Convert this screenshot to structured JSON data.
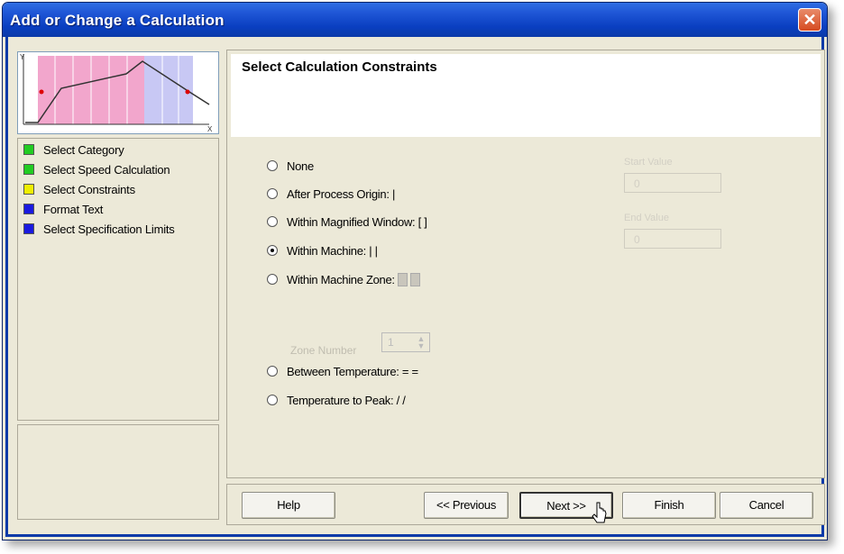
{
  "window": {
    "title": "Add or Change a Calculation",
    "close_label": "✕"
  },
  "preview": {
    "axis_y": "Y",
    "axis_x": "X"
  },
  "steps": [
    {
      "label": "Select Category",
      "color": "#22cc22"
    },
    {
      "label": "Select Speed Calculation",
      "color": "#22cc22"
    },
    {
      "label": "Select Constraints",
      "color": "#eeee00"
    },
    {
      "label": "Format Text",
      "color": "#1a1adf"
    },
    {
      "label": "Select Specification Limits",
      "color": "#1a1adf"
    }
  ],
  "main": {
    "title": "Select Calculation Constraints",
    "options": [
      {
        "label": "None",
        "checked": false
      },
      {
        "label": "After Process Origin: |",
        "checked": false
      },
      {
        "label": "Within Magnified Window: [  ]",
        "checked": false
      },
      {
        "label": "Within Machine: |  |",
        "checked": true
      },
      {
        "label": "Within Machine Zone:",
        "checked": false
      },
      {
        "label": "Between Temperature: =  =",
        "checked": false
      },
      {
        "label": "Temperature to Peak: /  /",
        "checked": false
      }
    ],
    "zone_number_label": "Zone Number",
    "zone_number_value": "1",
    "start_value_label": "Start Value",
    "start_value": "0",
    "end_value_label": "End Value",
    "end_value": "0"
  },
  "buttons": {
    "help": "Help",
    "previous": "<< Previous",
    "next": "Next >>",
    "finish": "Finish",
    "cancel": "Cancel"
  }
}
